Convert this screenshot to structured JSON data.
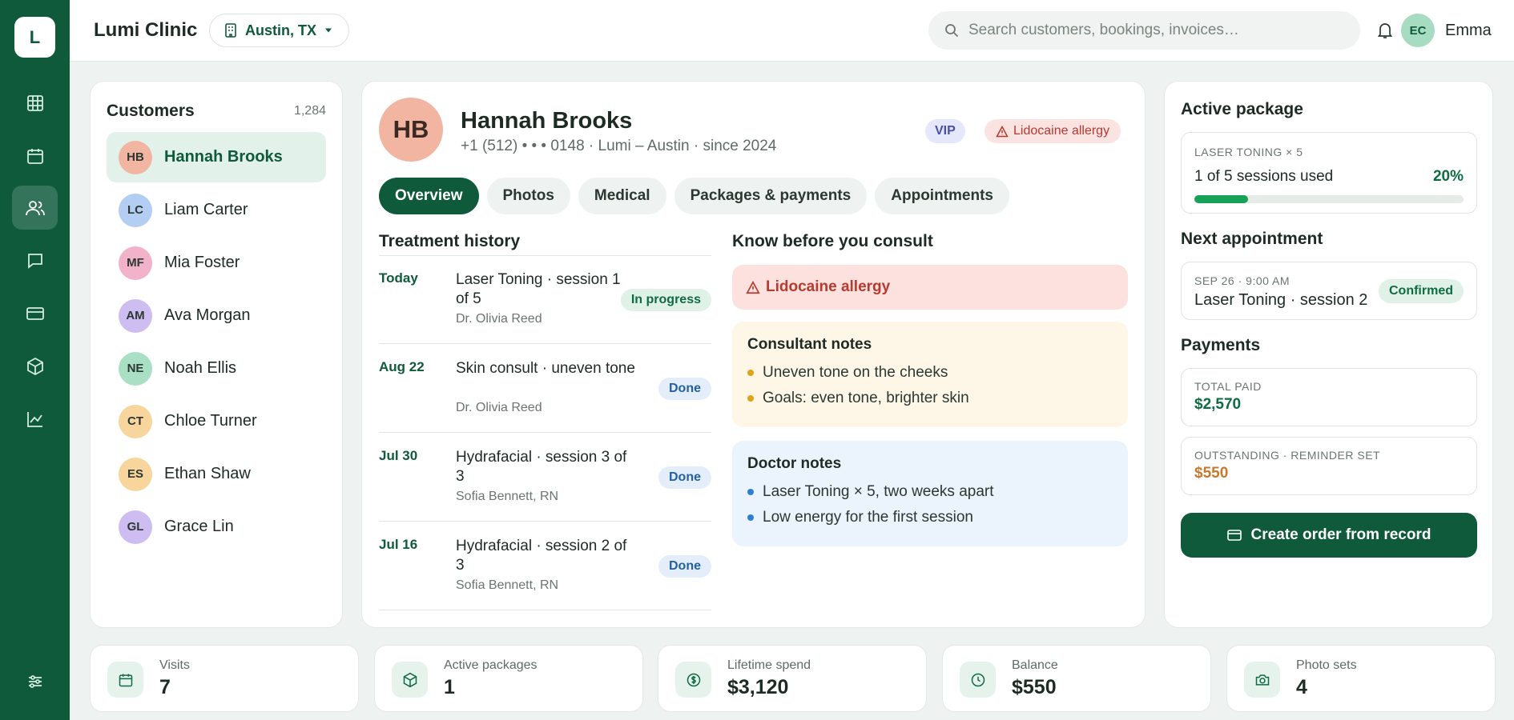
{
  "app": {
    "title": "Lumi Clinic",
    "logo_letter": "L"
  },
  "location": {
    "label": "Austin, TX"
  },
  "search": {
    "placeholder": "Search customers, bookings, invoices…"
  },
  "user": {
    "initials": "EC",
    "name": "Emma"
  },
  "sidebar": {
    "items": [
      {
        "name": "dashboard",
        "icon": "grid-icon"
      },
      {
        "name": "calendar",
        "icon": "calendar-icon"
      },
      {
        "name": "customers",
        "icon": "users-icon",
        "active": true
      },
      {
        "name": "messages",
        "icon": "chat-icon"
      },
      {
        "name": "payments",
        "icon": "card-icon"
      },
      {
        "name": "inventory",
        "icon": "box-icon"
      },
      {
        "name": "reports",
        "icon": "chart-icon"
      }
    ],
    "bottom_icon": "sliders-icon"
  },
  "customers": {
    "title": "Customers",
    "count": "1,284",
    "list": [
      {
        "initials": "HB",
        "name": "Hannah Brooks",
        "color": "#f2b5a2",
        "selected": true
      },
      {
        "initials": "LC",
        "name": "Liam Carter",
        "color": "#b3cdf3"
      },
      {
        "initials": "MF",
        "name": "Mia Foster",
        "color": "#f2b3ca"
      },
      {
        "initials": "AM",
        "name": "Ava Morgan",
        "color": "#cdbdf0"
      },
      {
        "initials": "NE",
        "name": "Noah Ellis",
        "color": "#a9dfc4"
      },
      {
        "initials": "CT",
        "name": "Chloe Turner",
        "color": "#f7d59c"
      },
      {
        "initials": "ES",
        "name": "Ethan Shaw",
        "color": "#f7d59c"
      },
      {
        "initials": "GL",
        "name": "Grace Lin",
        "color": "#cdbdf0"
      }
    ]
  },
  "profile": {
    "initials": "HB",
    "name": "Hannah Brooks",
    "meta": "+1 (512) • • • 0148 · Lumi – Austin · since 2024",
    "vip": "VIP",
    "allergy_badge": "Lidocaine allergy",
    "tabs": [
      "Overview",
      "Photos",
      "Medical",
      "Packages & payments",
      "Appointments"
    ]
  },
  "history": {
    "title": "Treatment history",
    "rows": [
      {
        "date": "Today",
        "title": "Laser Toning · session 1 of 5",
        "doctor": "Dr. Olivia Reed",
        "status": "In progress",
        "kind": "prog"
      },
      {
        "date": "Aug 22",
        "title": "Skin consult · uneven tone",
        "doctor": "Dr. Olivia Reed",
        "status": "Done",
        "kind": "done"
      },
      {
        "date": "Jul 30",
        "title": "Hydrafacial · session 3 of 3",
        "doctor": "Sofia Bennett, RN",
        "status": "Done",
        "kind": "done"
      },
      {
        "date": "Jul 16",
        "title": "Hydrafacial · session 2 of 3",
        "doctor": "Sofia Bennett, RN",
        "status": "Done",
        "kind": "done"
      }
    ]
  },
  "know": {
    "title": "Know before you consult",
    "allergy": "Lidocaine allergy",
    "consultant": {
      "title": "Consultant notes",
      "lines": [
        "Uneven tone on the cheeks",
        "Goals: even tone, brighter skin"
      ],
      "dot_color": "#e0a21a"
    },
    "doctor": {
      "title": "Doctor notes",
      "lines": [
        "Laser Toning × 5, two weeks apart",
        "Low energy for the first session"
      ],
      "dot_color": "#2f7fd0"
    }
  },
  "package": {
    "title": "Active package",
    "name": "LASER TONING × 5",
    "used": "1 of 5 sessions used",
    "percent_label": "20%",
    "progress": 0.2
  },
  "appointment": {
    "title": "Next appointment",
    "when": "SEP 26 · 9:00 AM",
    "what": "Laser Toning · session 2",
    "status": "Confirmed"
  },
  "payments": {
    "title": "Payments",
    "paid_label": "TOTAL PAID",
    "paid_value": "$2,570",
    "paid_color": "#0e6b42",
    "outstanding_label": "OUTSTANDING · REMINDER SET",
    "outstanding_value": "$550",
    "outstanding_color": "#c9772a",
    "cta": "Create order from record"
  },
  "stats": [
    {
      "label": "Visits",
      "value": "7",
      "icon": "calendar-icon"
    },
    {
      "label": "Active packages",
      "value": "1",
      "icon": "box-icon"
    },
    {
      "label": "Lifetime spend",
      "value": "$3,120",
      "icon": "dollar-icon"
    },
    {
      "label": "Balance",
      "value": "$550",
      "icon": "clock-icon"
    },
    {
      "label": "Photo sets",
      "value": "4",
      "icon": "camera-icon"
    }
  ]
}
